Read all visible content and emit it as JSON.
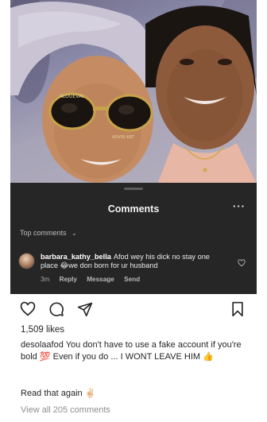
{
  "photo": {
    "sunglasses_text": "ALOUEVAL",
    "sunglasses_subtext": "ADVISI KAT"
  },
  "sheet": {
    "title": "Comments",
    "more": "···",
    "filter_label": "Top comments",
    "filter_icon": "chevron-down-icon"
  },
  "comment": {
    "username": "barbara_kathy_bella",
    "text": "Afod wey his dick no stay one place 😂we don born for ur husband",
    "time": "3m",
    "reply": "Reply",
    "message": "Message",
    "send": "Send"
  },
  "post": {
    "likes": "1,509 likes",
    "caption_user": "desolaafod",
    "caption_text": "You don't have to use a fake account if you're bold 💯 Even if you do ... I WONT LEAVE HIM 👍",
    "read_again": "Read that again ✌🏻",
    "view_all": "View all 205 comments"
  },
  "colors": {
    "sheet_bg": "#262626",
    "text_dark": "#262626",
    "muted": "#8e8e8e"
  }
}
